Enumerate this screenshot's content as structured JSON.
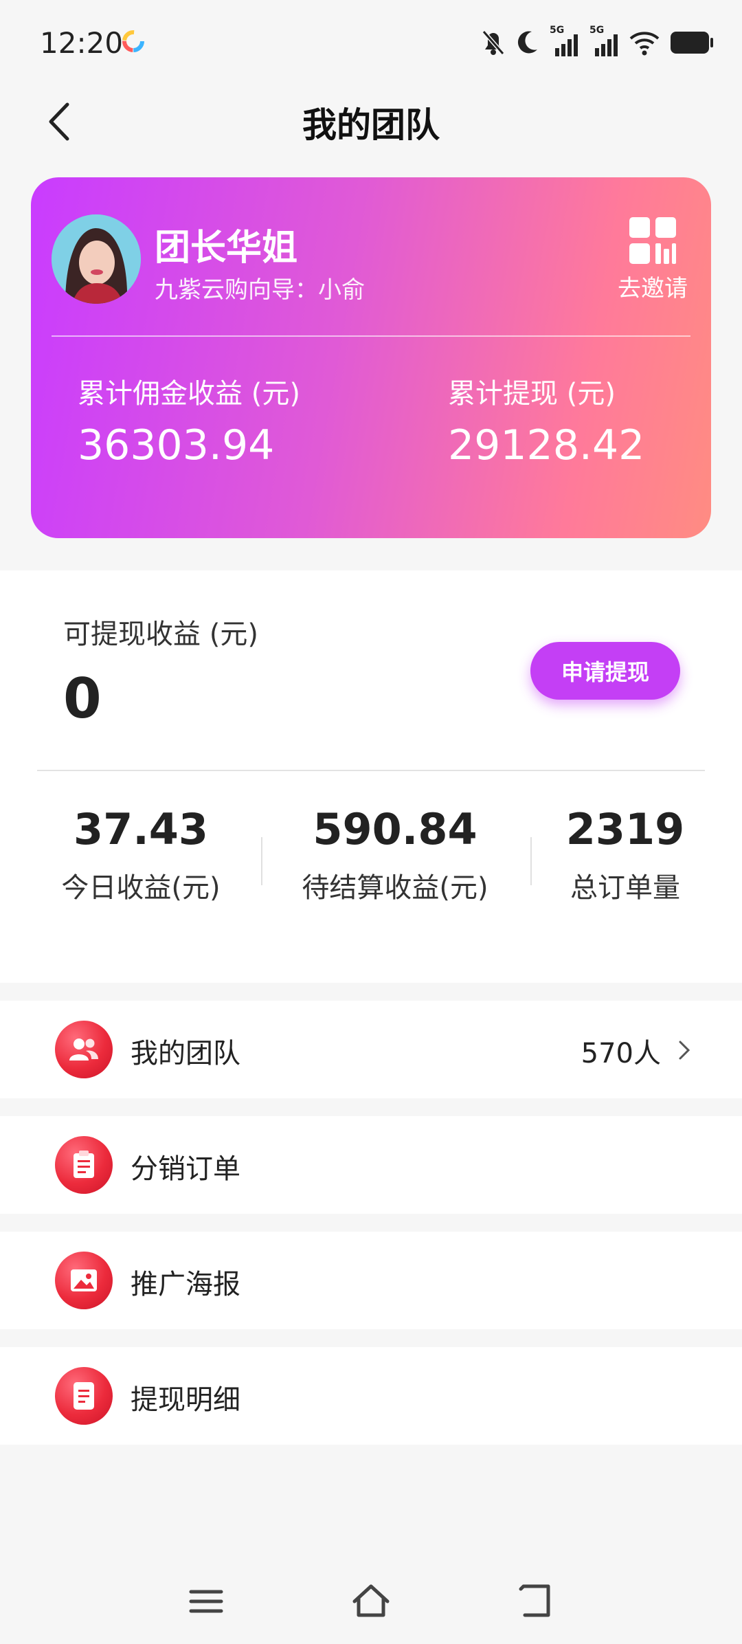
{
  "status_bar": {
    "time": "12:20",
    "icons": [
      "app-icon",
      "bell-off-icon",
      "moon-icon",
      "signal-5g-icon",
      "signal-5g-icon",
      "wifi-icon",
      "battery-icon"
    ],
    "signal_label_1": "5G",
    "signal_label_2": "5G"
  },
  "header": {
    "title": "我的团队",
    "back_icon": "chevron-left-icon"
  },
  "profile": {
    "name": "团长华姐",
    "guide": "九紫云购向导：小俞",
    "invite_label": "去邀请",
    "total_commission_label": "累计佣金收益 (元)",
    "total_commission_value": "36303.94",
    "total_withdrawn_label": "累计提现 (元)",
    "total_withdrawn_value": "29128.42"
  },
  "withdraw": {
    "available_label": "可提现收益 (元)",
    "available_value": "0",
    "apply_button": "申请提现"
  },
  "stats": [
    {
      "value": "37.43",
      "label": "今日收益(元)"
    },
    {
      "value": "590.84",
      "label": "待结算收益(元)"
    },
    {
      "value": "2319",
      "label": "总订单量"
    }
  ],
  "menu": [
    {
      "label": "我的团队",
      "count": "570人",
      "icon": "team-icon"
    },
    {
      "label": "分销订单",
      "count": "",
      "icon": "order-icon"
    },
    {
      "label": "推广海报",
      "count": "",
      "icon": "poster-icon"
    },
    {
      "label": "提现明细",
      "count": "",
      "icon": "detail-icon"
    }
  ],
  "colors": {
    "card_gradient_start": "#c93cff",
    "card_gradient_end": "#ff8c82",
    "accent_purple": "#c43ff5",
    "menu_icon_red": "#ec2b3c"
  },
  "nav_bar": [
    "menu-icon",
    "home-icon",
    "back-icon"
  ]
}
